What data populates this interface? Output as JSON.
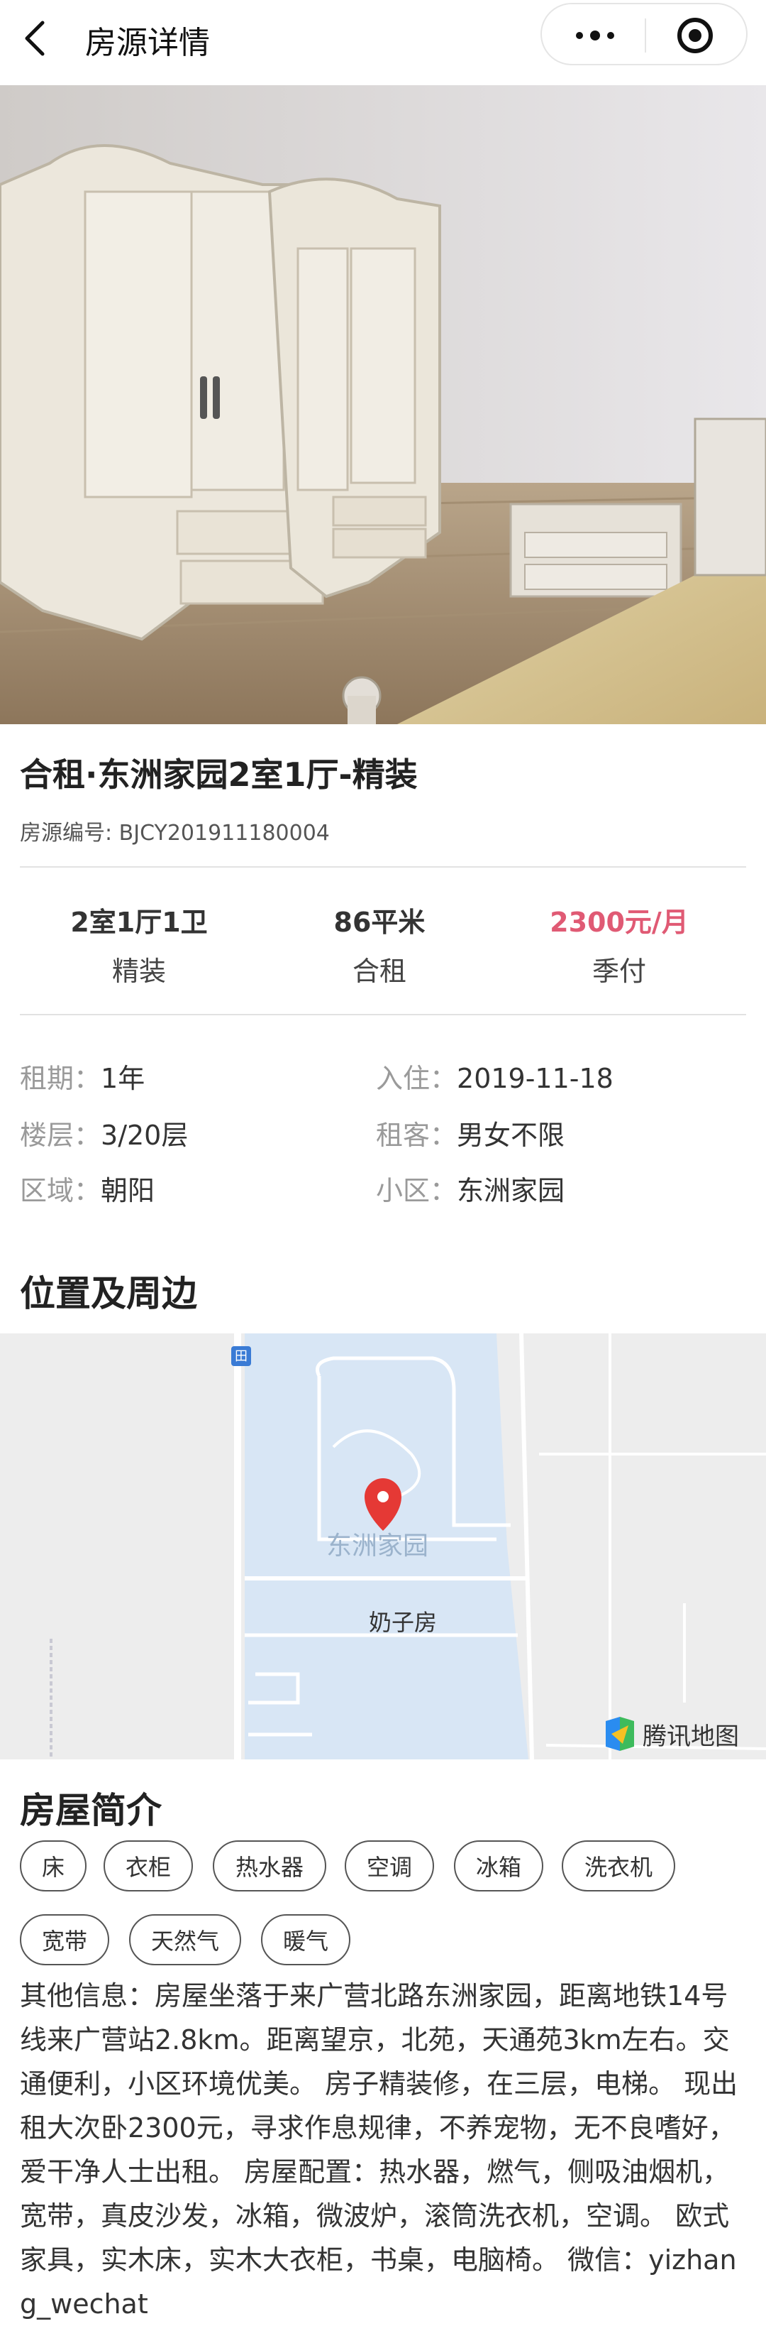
{
  "nav": {
    "title": "房源详情"
  },
  "listing": {
    "title": "合租·东洲家园2室1厅-精装",
    "code_label": "房源编号: ",
    "code": "BJCY201911180004"
  },
  "stats": [
    {
      "value": "2室1厅1卫",
      "sub": "精装"
    },
    {
      "value": "86平米",
      "sub": "合租"
    },
    {
      "value": "2300元/月",
      "sub": "季付"
    }
  ],
  "details": {
    "lease": {
      "label": "租期：",
      "value": "1年"
    },
    "movein": {
      "label": "入住：",
      "value": "2019-11-18"
    },
    "floor": {
      "label": "楼层：",
      "value": "3/20层"
    },
    "tenant": {
      "label": "租客：",
      "value": "男女不限"
    },
    "district": {
      "label": "区域：",
      "value": "朝阳"
    },
    "community": {
      "label": "小区：",
      "value": "东洲家园"
    }
  },
  "location": {
    "title": "位置及周边",
    "map_place": "东洲家园",
    "map_poi": "奶子房",
    "map_brand": "腾讯地图"
  },
  "intro": {
    "title": "房屋简介",
    "tags": [
      "床",
      "衣柜",
      "热水器",
      "空调",
      "冰箱",
      "洗衣机",
      "宽带",
      "天然气",
      "暖气"
    ],
    "description": "其他信息：房屋坐落于来广营北路东洲家园，距离地铁14号线来广营站2.8km。距离望京，北苑，天通苑3km左右。交通便利，小区环境优美。 房子精装修，在三层，电梯。 现出租大次卧2300元，寻求作息规律，不养宠物，无不良嗜好，爱干净人士出租。 房屋配置：热水器，燃气，侧吸油烟机，宽带，真皮沙发，冰箱，微波炉，滚筒洗衣机，空调。 欧式家具，实木床，实木大衣柜，书桌，电脑椅。 微信：yizhang_wechat"
  },
  "gallery": {
    "count": 4,
    "active_index": 3
  },
  "colors": {
    "price": "#e05a74",
    "map_water": "#d8e6f5",
    "pin": "#e53935"
  }
}
